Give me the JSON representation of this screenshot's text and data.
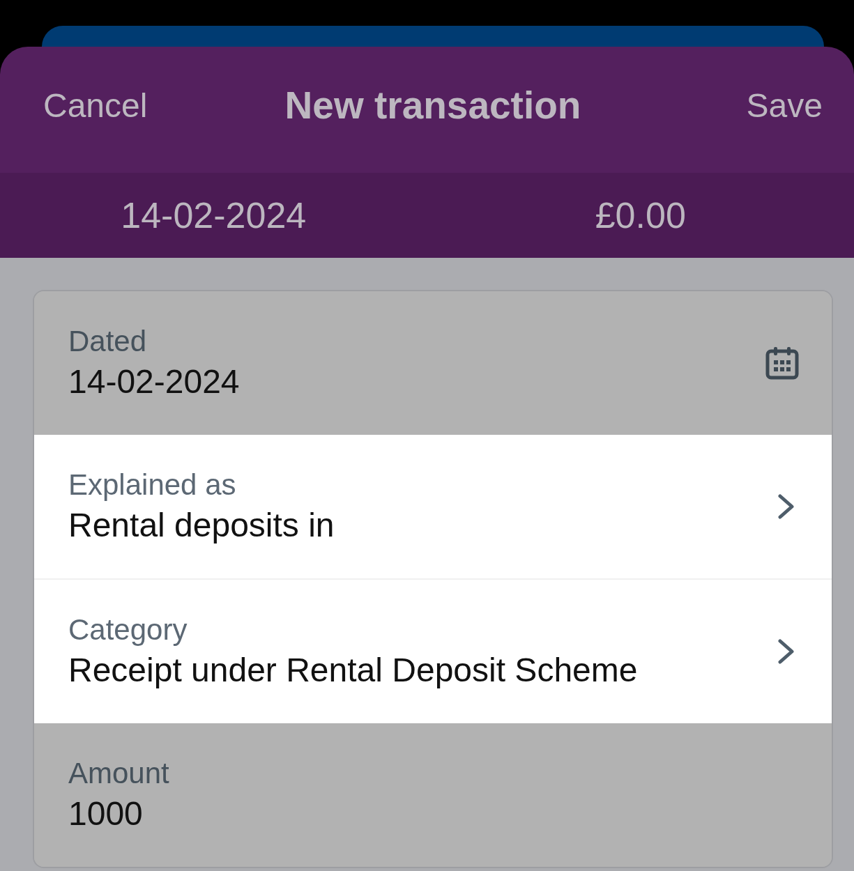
{
  "header": {
    "cancel": "Cancel",
    "title": "New transaction",
    "save": "Save"
  },
  "summary": {
    "date": "14-02-2024",
    "amount": "£0.00"
  },
  "fields": [
    {
      "kind": "date",
      "label": "Dated",
      "value": "14-02-2024",
      "highlighted": false
    },
    {
      "kind": "picker",
      "label": "Explained as",
      "value": "Rental deposits in",
      "highlighted": true
    },
    {
      "kind": "picker",
      "label": "Category",
      "value": "Receipt under Rental Deposit Scheme",
      "highlighted": true
    },
    {
      "kind": "text",
      "label": "Amount",
      "value": "1000",
      "highlighted": false
    }
  ]
}
